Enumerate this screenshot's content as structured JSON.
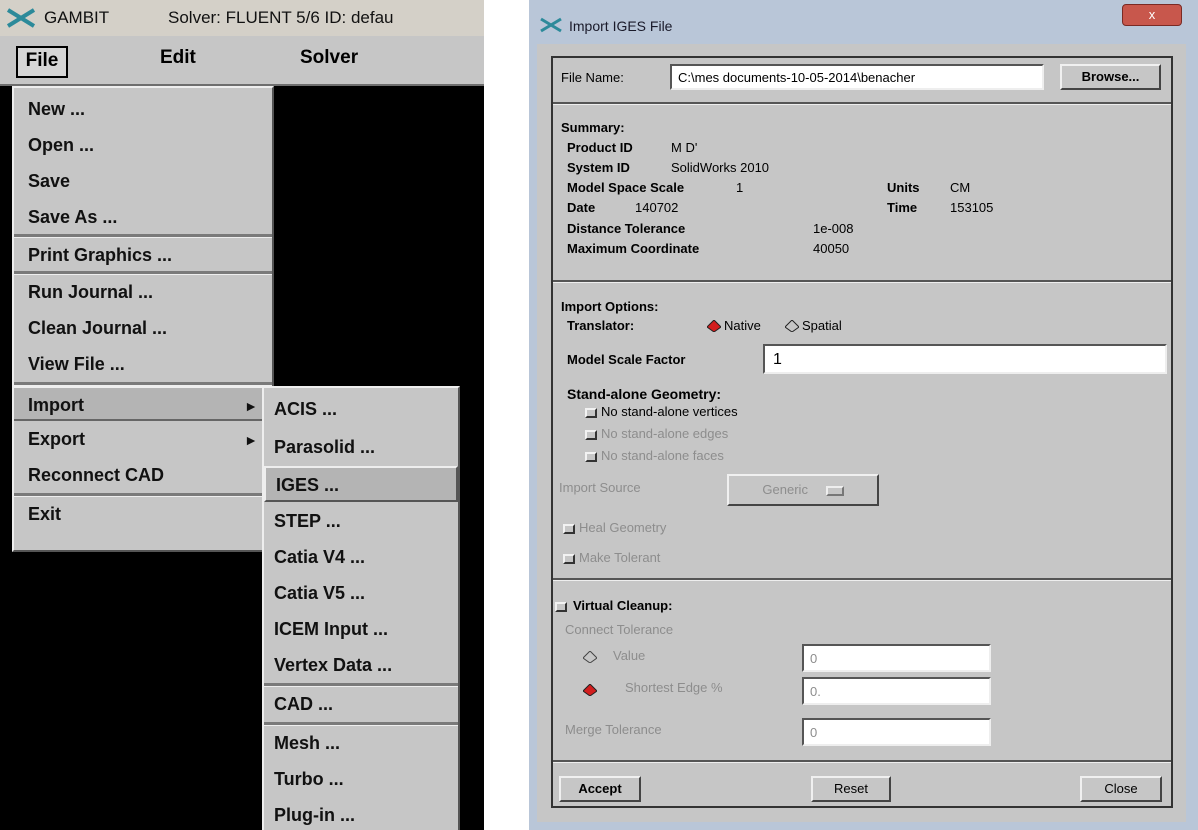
{
  "gambit": {
    "app_title": "GAMBIT",
    "solver_info": "Solver: FLUENT 5/6   ID: defau",
    "menubar": {
      "file": "File",
      "edit": "Edit",
      "solver": "Solver"
    },
    "file_menu": {
      "items": [
        "New ...",
        "Open ...",
        "Save",
        "Save As ...",
        "Print Graphics ...",
        "Run Journal ...",
        "Clean Journal ...",
        "View File ...",
        "Import",
        "Export",
        "Reconnect CAD",
        "Exit"
      ],
      "submenu_arrow": "►"
    },
    "import_menu": {
      "items": [
        "ACIS ...",
        "Parasolid ...",
        "IGES ...",
        "STEP ...",
        "Catia V4 ...",
        "Catia V5 ...",
        "ICEM Input ...",
        "Vertex Data ...",
        "CAD ...",
        "Mesh ...",
        "Turbo ...",
        "Plug-in ..."
      ]
    }
  },
  "dialog": {
    "title": "Import IGES File",
    "close_label": "x",
    "file_name_label": "File Name:",
    "file_name_value": "C:\\mes documents-10-05-2014\\benacher",
    "browse_label": "Browse...",
    "summary": {
      "heading": "Summary:",
      "product_id_label": "Product ID",
      "product_id_value": "M D'",
      "system_id_label": "System ID",
      "system_id_value": "SolidWorks 2010",
      "model_space_scale_label": "Model Space Scale",
      "model_space_scale_value": "1",
      "units_label": "Units",
      "units_value": "CM",
      "date_label": "Date",
      "date_value": "140702",
      "time_label": "Time",
      "time_value": "153105",
      "distance_tolerance_label": "Distance Tolerance",
      "distance_tolerance_value": "1e-008",
      "maximum_coordinate_label": "Maximum Coordinate",
      "maximum_coordinate_value": "40050"
    },
    "import_options": {
      "heading": "Import Options:",
      "translator_label": "Translator:",
      "translator_native": "Native",
      "translator_spatial": "Spatial",
      "translator_selected": "Native",
      "model_scale_factor_label": "Model Scale Factor",
      "model_scale_factor_value": "1",
      "standalone_heading": "Stand-alone Geometry:",
      "no_standalone_vertices": "No stand-alone vertices",
      "no_standalone_edges": "No stand-alone edges",
      "no_standalone_faces": "No stand-alone faces",
      "import_source_label": "Import Source",
      "import_source_value": "Generic",
      "heal_geometry": "Heal Geometry",
      "make_tolerant": "Make Tolerant"
    },
    "virtual_cleanup": {
      "heading": "Virtual Cleanup:",
      "connect_tolerance_label": "Connect Tolerance",
      "value_label": "Value",
      "value_value": "0",
      "shortest_edge_label": "Shortest Edge %",
      "shortest_edge_value": "0.",
      "shortest_edge_selected": true,
      "merge_tolerance_label": "Merge Tolerance",
      "merge_tolerance_value": "0"
    },
    "buttons": {
      "accept": "Accept",
      "reset": "Reset",
      "close": "Close"
    }
  }
}
